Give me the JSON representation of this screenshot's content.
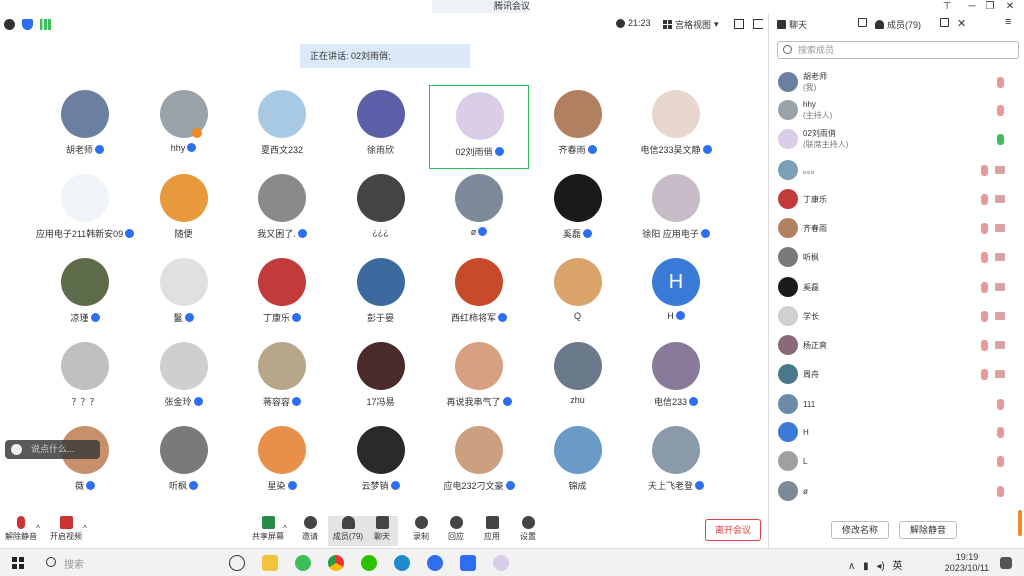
{
  "window": {
    "title": "腾讯会议",
    "minimize": "─",
    "restore": "❐",
    "close": "✕",
    "pin": "⊤"
  },
  "topbar": {
    "time": "21:23",
    "view_label": "宫格视图"
  },
  "speaking_text": "正在讲话: 02刘雨俏;",
  "participants": [
    {
      "name": "胡老师",
      "mic": true,
      "color": "#6b7fa0"
    },
    {
      "name": "hhy",
      "mic": true,
      "color": "#9aa3aa",
      "host": true
    },
    {
      "name": "夏西文232",
      "mic": false,
      "color": "#a8c9e4"
    },
    {
      "name": "徐雨欣",
      "mic": false,
      "color": "#5a5fa8"
    },
    {
      "name": "02刘雨俏",
      "mic": true,
      "color": "#d9cde8",
      "active": true
    },
    {
      "name": "齐春雨",
      "mic": true,
      "color": "#b08060"
    },
    {
      "name": "电信233吴文静",
      "mic": true,
      "color": "#e8d7cf"
    },
    {
      "name": "应用电子211韩新安09",
      "mic": true,
      "color": "#f0f4f8"
    },
    {
      "name": "随便",
      "mic": false,
      "color": "#e89a3c"
    },
    {
      "name": "我又困了.",
      "mic": true,
      "color": "#8a8a8a"
    },
    {
      "name": "¿¿¿",
      "mic": false,
      "color": "#444"
    },
    {
      "name": "ø",
      "mic": true,
      "color": "#7d8a99"
    },
    {
      "name": "奚磊",
      "mic": true,
      "color": "#1a1a1a"
    },
    {
      "name": "徐阳 应用电子",
      "mic": true,
      "color": "#c9bcc9"
    },
    {
      "name": "凉瑾",
      "mic": true,
      "color": "#5e6b4a"
    },
    {
      "name": "鬣",
      "mic": true,
      "color": "#e0e0e0"
    },
    {
      "name": "丁康乐",
      "mic": true,
      "color": "#c23a3a"
    },
    {
      "name": "彭于晏",
      "mic": false,
      "color": "#3d6a9e"
    },
    {
      "name": "西红柿将军",
      "mic": true,
      "color": "#c94a2a"
    },
    {
      "name": "Q",
      "mic": false,
      "color": "#d9a36a"
    },
    {
      "name": "H",
      "mic": true,
      "color": "#3b7bd8",
      "letter": "H"
    },
    {
      "name": "？？？",
      "mic": false,
      "color": "#c0c0c0"
    },
    {
      "name": "张金玲",
      "mic": true,
      "color": "#cfcfcf"
    },
    {
      "name": "蒋容容",
      "mic": true,
      "color": "#b8a68a"
    },
    {
      "name": "17冯易",
      "mic": false,
      "color": "#4a2a2a"
    },
    {
      "name": "再说我串气了",
      "mic": true,
      "color": "#d8a080"
    },
    {
      "name": "zhu",
      "mic": false,
      "color": "#6a7a8a"
    },
    {
      "name": "电信233",
      "mic": true,
      "color": "#8a7a9a"
    },
    {
      "name": "薇",
      "mic": true,
      "color": "#c8906a"
    },
    {
      "name": "听枫",
      "mic": true,
      "color": "#7a7a7a"
    },
    {
      "name": "星染",
      "mic": true,
      "color": "#e8904a"
    },
    {
      "name": "云梦销",
      "mic": true,
      "color": "#2a2a2a"
    },
    {
      "name": "应电232刁文豪",
      "mic": true,
      "color": "#caa080"
    },
    {
      "name": "锦成",
      "mic": false,
      "color": "#6a9ac8"
    },
    {
      "name": "天上飞老登",
      "mic": true,
      "color": "#8a9aa8"
    }
  ],
  "chat_bubble": "说点什么...",
  "toolbar": {
    "mute": "解除静音",
    "video": "开启视频",
    "share": "共享屏幕",
    "invite": "邀请",
    "members": "成员(79)",
    "chat": "聊天",
    "record": "录制",
    "react": "回应",
    "apps": "应用",
    "settings": "设置",
    "leave": "离开会议"
  },
  "panel": {
    "chat_tab": "聊天",
    "members_tab": "成员(79)",
    "search_placeholder": "搜索成员",
    "rename_button": "修改名称",
    "unmute_button": "解除静音"
  },
  "members": [
    {
      "name": "胡老师",
      "sub": "(我)",
      "color": "#6b7fa0",
      "mic": "off",
      "cam": false
    },
    {
      "name": "hhy",
      "sub": "(主持人)",
      "color": "#9aa3aa",
      "mic": "off",
      "cam": false
    },
    {
      "name": "02刘雨俏",
      "sub": "(联席主持人)",
      "color": "#d9cde8",
      "mic": "on",
      "cam": false
    },
    {
      "name": "。。。",
      "sub": "",
      "color": "#7aa0b8",
      "mic": "off",
      "cam": true
    },
    {
      "name": "丁康乐",
      "sub": "",
      "color": "#c23a3a",
      "mic": "off",
      "cam": true
    },
    {
      "name": "齐春雨",
      "sub": "",
      "color": "#b08060",
      "mic": "off",
      "cam": true
    },
    {
      "name": "听枫",
      "sub": "",
      "color": "#7a7a7a",
      "mic": "off",
      "cam": true
    },
    {
      "name": "奚磊",
      "sub": "",
      "color": "#1a1a1a",
      "mic": "off",
      "cam": true
    },
    {
      "name": "学长",
      "sub": "",
      "color": "#d0d0d0",
      "mic": "off",
      "cam": true
    },
    {
      "name": "杨正爽",
      "sub": "",
      "color": "#8a6a7a",
      "mic": "off",
      "cam": true
    },
    {
      "name": "周舟",
      "sub": "",
      "color": "#4a7a8a",
      "mic": "off",
      "cam": true
    },
    {
      "name": "111",
      "sub": "",
      "color": "#6a8aa8",
      "mic": "off",
      "cam": false
    },
    {
      "name": "H",
      "sub": "",
      "color": "#3b7bd8",
      "mic": "off",
      "cam": false
    },
    {
      "name": "L",
      "sub": "",
      "color": "#a0a0a0",
      "mic": "off",
      "cam": false
    },
    {
      "name": "ø",
      "sub": "",
      "color": "#7d8a99",
      "mic": "off",
      "cam": false
    }
  ],
  "taskbar": {
    "search_placeholder": "搜索",
    "ime": "英",
    "time": "19:19",
    "date": "2023/10/11"
  }
}
